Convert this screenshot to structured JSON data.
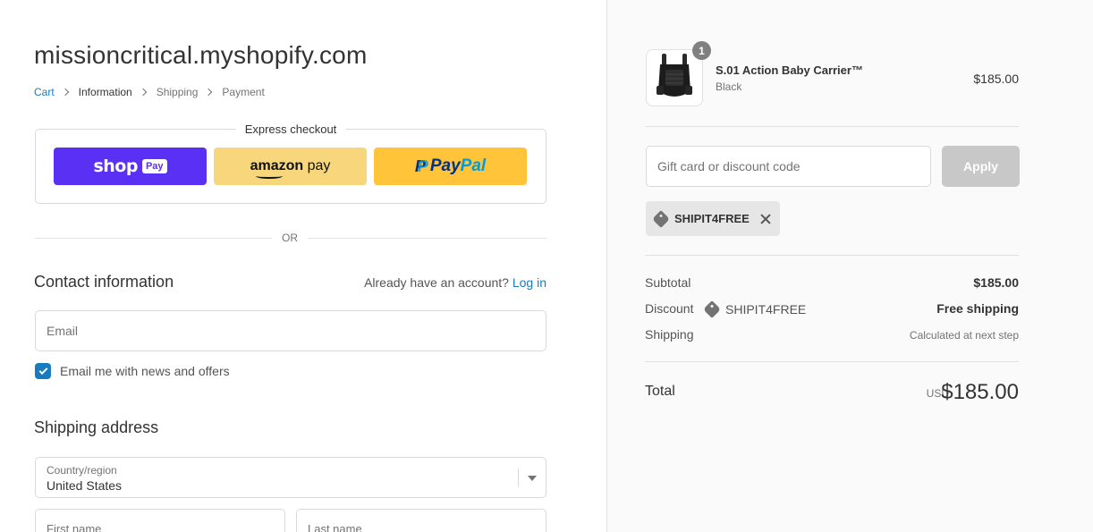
{
  "shop": {
    "title": "missioncritical.myshopify.com"
  },
  "breadcrumb": {
    "cart": "Cart",
    "information": "Information",
    "shipping": "Shipping",
    "payment": "Payment"
  },
  "express": {
    "title": "Express checkout",
    "shoppay_label": "shop",
    "shoppay_badge": "Pay",
    "amazon_label": "amazon",
    "amazon_pay": "pay",
    "paypal_p1": "Pay",
    "paypal_p2": "Pal"
  },
  "divider_or": "OR",
  "contact": {
    "title": "Contact information",
    "account_prompt": "Already have an account?",
    "login_label": "Log in",
    "email_placeholder": "Email",
    "newsletter_label": "Email me with news and offers",
    "newsletter_checked": true
  },
  "shipping_address": {
    "title": "Shipping address",
    "country_label": "Country/region",
    "country_value": "United States",
    "first_name_label": "First name",
    "last_name_label": "Last name"
  },
  "order": {
    "product": {
      "name": "S.01 Action Baby Carrier™",
      "variant": "Black",
      "price": "$185.00",
      "quantity": "1"
    },
    "discount_placeholder": "Gift card or discount code",
    "apply_label": "Apply",
    "applied_code": "SHIPIT4FREE",
    "subtotal_label": "Subtotal",
    "subtotal_value": "$185.00",
    "discount_label": "Discount",
    "discount_code": "SHIPIT4FREE",
    "discount_value": "Free shipping",
    "shipping_label": "Shipping",
    "shipping_value": "Calculated at next step",
    "total_label": "Total",
    "total_currency": "USD",
    "total_value": "$185.00"
  },
  "colors": {
    "accent": "#197bbd",
    "shoppay": "#5a31f4",
    "amazonpay": "#f7d67c",
    "paypal": "#ffc439",
    "apply_disabled": "#c8c8c8"
  }
}
